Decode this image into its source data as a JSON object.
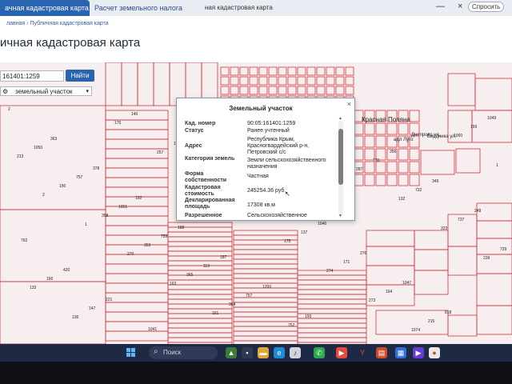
{
  "browser": {
    "tab_active": "ачная кадастровая карта",
    "tab_tax": "Расчет земельного налога",
    "tab_page": "ная кадастровая карта",
    "ask_label": "Спросить",
    "minimize_glyph": "—",
    "close_glyph": "×"
  },
  "page": {
    "breadcrumb": "лавная › Публичная кадастровая карта",
    "title": "ичная кадастровая карта"
  },
  "search": {
    "value": "161401:1259",
    "button": "Найти"
  },
  "object_type": {
    "selected": "земельный участок",
    "chevron": "▾"
  },
  "popup": {
    "title": "Земельный участок",
    "close": "×",
    "rows": [
      {
        "label": "Кад. номер",
        "value": "90:05:161401:1259"
      },
      {
        "label": "Статус",
        "value": "Ранее учтенный"
      },
      {
        "label": "Адрес",
        "value": "Республика Крым, Красногвардейский р-н, Петровский с/с"
      },
      {
        "label": "Категория земель",
        "value": "Земли сельскохозяйственного назначения"
      },
      {
        "label": "Форма собственности",
        "value": "Частная"
      },
      {
        "label": "Кадастровая стоимость",
        "value": "245254.36 руб."
      },
      {
        "label": "Декларированная площадь",
        "value": "17308 кв.м"
      },
      {
        "label": "Разрешенное",
        "value": "Сельскохозяйственное"
      }
    ]
  },
  "map": {
    "place_labels": [
      "Красная Поляна",
      "Днепровс ул.",
      "Бердника ул.",
      "адл Луго"
    ],
    "parcel_numbers": [
      "2",
      "363",
      "378",
      "192",
      "188",
      "187",
      "1200",
      "193",
      "199",
      "356",
      "349",
      "248",
      "762",
      "420",
      "221",
      "1041",
      "749",
      "1043",
      "1044",
      "1046",
      "276",
      "1047",
      "818",
      "1049",
      "1050",
      "757",
      "1051",
      "759",
      "119",
      "757",
      "752",
      "734",
      "733",
      "732",
      "737",
      "729",
      "166",
      "147",
      "140",
      "152",
      "175",
      "150",
      "137",
      "171",
      "164",
      "215",
      "159",
      "213",
      "150",
      "358",
      "359",
      "365",
      "364",
      "376",
      "127",
      "287",
      "132",
      "323",
      "239",
      "133",
      "136",
      "176",
      "257",
      "10",
      "174",
      "175",
      "274",
      "273",
      "1074",
      "1060",
      "1",
      "2",
      "1",
      "270",
      "163",
      "161",
      "104"
    ],
    "colors": {
      "boundary": "#d0343a",
      "fill": "#f7efef"
    }
  },
  "taskbar": {
    "search_label": "Поиск",
    "search_icon": "magnifier-icon",
    "start_icon": "windows-logo-icon",
    "icons": [
      "widgets-icon",
      "camera-icon",
      "file-explorer-icon",
      "edge-icon",
      "music-icon",
      "whatsapp-icon",
      "media-player-icon",
      "yandex-browser-icon",
      "office-icon",
      "store-icon",
      "video-icon",
      "chrome-icon"
    ]
  }
}
